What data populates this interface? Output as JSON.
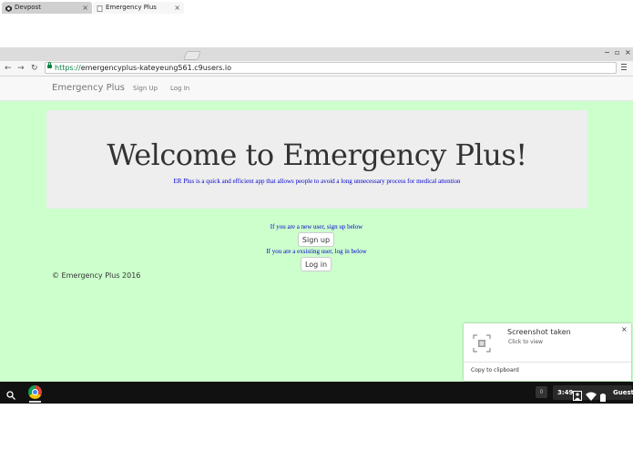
{
  "browser": {
    "tabs": [
      {
        "label": "Devpost",
        "active": false
      },
      {
        "label": "Emergency Plus",
        "active": true
      }
    ],
    "url_scheme": "https://",
    "url_host": "emergencyplus-kateyeung561.c9users.io"
  },
  "navbar": {
    "brand": "Emergency Plus",
    "links": [
      "Sign Up",
      "Log In"
    ]
  },
  "jumbotron": {
    "heading": "Welcome to Emergency Plus!",
    "lead": "ER Plus is a quick and efficient app that allows people to avoid a long unnecessary process for medical attention"
  },
  "auth": {
    "new_user_prompt": "If you are a new user, sign up below",
    "signup_label": "Sign up",
    "existing_user_prompt": "If you are a exsisting user, log in below",
    "login_label": "Log in"
  },
  "footer": "© Emergency Plus 2016",
  "notification": {
    "title": "Screenshot taken",
    "subtitle": "Click to view",
    "action": "Copy to clipboard"
  },
  "shelf": {
    "ime": "0",
    "clock": "3:49",
    "user": "Guest"
  },
  "colors": {
    "page_background": "#ccffcc",
    "jumbotron_background": "#eeeeee",
    "accent_text": "#0000cc",
    "secure_green": "#0b8043"
  },
  "icons": [
    "devpost-favicon",
    "page-favicon",
    "back-icon",
    "forward-icon",
    "reload-icon",
    "lock-icon",
    "menu-icon",
    "close-icon",
    "screenshot-thumbnail-icon",
    "search-icon",
    "chrome-icon",
    "wifi-icon",
    "battery-icon",
    "avatar-icon"
  ]
}
